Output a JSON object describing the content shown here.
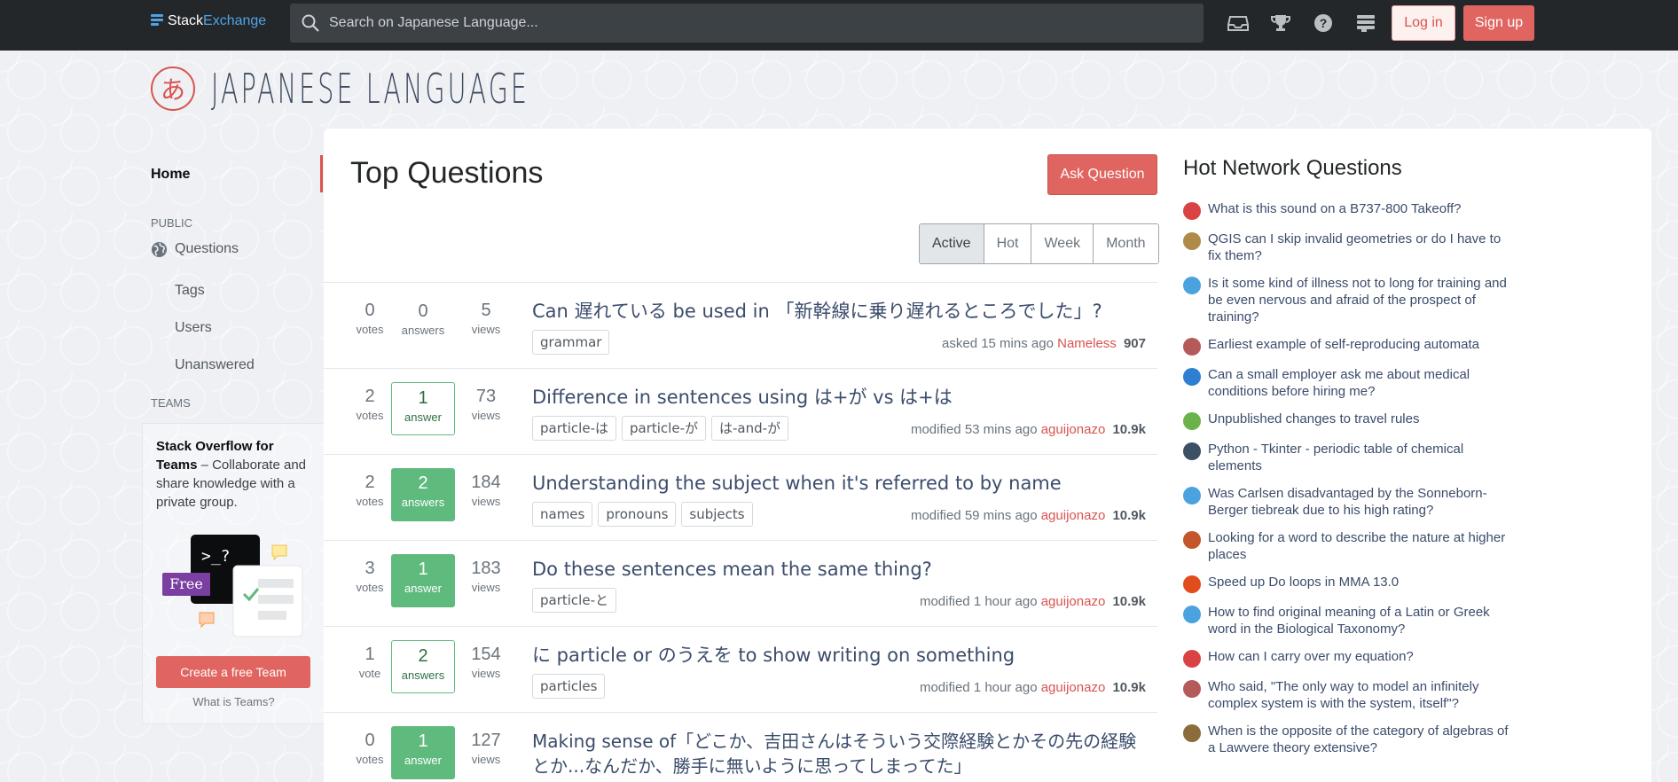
{
  "topbar": {
    "brand_part1": "Stack",
    "brand_part2": "Exchange",
    "search_placeholder": "Search on Japanese Language...",
    "icons": [
      "inbox-icon",
      "trophy-icon",
      "help-icon",
      "site-switcher-icon"
    ],
    "login": "Log in",
    "signup": "Sign up"
  },
  "site": {
    "logo_glyph": "あ",
    "name": "JAPANESE LANGUAGE"
  },
  "nav": {
    "home": "Home",
    "public_label": "PUBLIC",
    "questions": "Questions",
    "tags": "Tags",
    "users": "Users",
    "unanswered": "Unanswered",
    "teams_label": "TEAMS",
    "teams_bold": "Stack Overflow for Teams",
    "teams_rest": " – Collaborate and share knowledge with a private group.",
    "free_badge": "Free",
    "terminal_text": ">_?",
    "create_team": "Create a free Team",
    "what_is_teams": "What is Teams?"
  },
  "main": {
    "title": "Top Questions",
    "ask": "Ask Question",
    "filters": [
      "Active",
      "Hot",
      "Week",
      "Month"
    ],
    "questions": [
      {
        "votes": "0",
        "votes_label": "votes",
        "answers": "0",
        "answers_label": "answers",
        "answer_style": "none",
        "views": "5",
        "views_label": "views",
        "title": "Can 遅れている be used in 「新幹線に乗り遅れるところでした」?",
        "tags": [
          "grammar"
        ],
        "action": "asked 15 mins ago",
        "user": "Nameless",
        "rep": "907"
      },
      {
        "votes": "2",
        "votes_label": "votes",
        "answers": "1",
        "answers_label": "answer",
        "answer_style": "bordered",
        "views": "73",
        "views_label": "views",
        "title": "Difference in sentences using は+が vs は+は",
        "tags": [
          "particle-は",
          "particle-が",
          "は-and-が"
        ],
        "action": "modified 53 mins ago",
        "user": "aguijonazo",
        "rep": "10.9k"
      },
      {
        "votes": "2",
        "votes_label": "votes",
        "answers": "2",
        "answers_label": "answers",
        "answer_style": "accepted",
        "views": "184",
        "views_label": "views",
        "title": "Understanding the subject when it's referred to by name",
        "tags": [
          "names",
          "pronouns",
          "subjects"
        ],
        "action": "modified 59 mins ago",
        "user": "aguijonazo",
        "rep": "10.9k"
      },
      {
        "votes": "3",
        "votes_label": "votes",
        "answers": "1",
        "answers_label": "answer",
        "answer_style": "accepted",
        "views": "183",
        "views_label": "views",
        "title": "Do these sentences mean the same thing?",
        "tags": [
          "particle-と"
        ],
        "action": "modified 1 hour ago",
        "user": "aguijonazo",
        "rep": "10.9k"
      },
      {
        "votes": "1",
        "votes_label": "vote",
        "answers": "2",
        "answers_label": "answers",
        "answer_style": "bordered",
        "views": "154",
        "views_label": "views",
        "title": "に particle or のうえを to show writing on something",
        "tags": [
          "particles"
        ],
        "action": "modified 1 hour ago",
        "user": "aguijonazo",
        "rep": "10.9k"
      },
      {
        "votes": "0",
        "votes_label": "votes",
        "answers": "1",
        "answers_label": "answer",
        "answer_style": "accepted",
        "views": "127",
        "views_label": "views",
        "title": "Making sense of「どこか、吉田さんはそういう交際経験とかその先の経験とか...なんだか、勝手に無いように思ってしまってた」",
        "tags": [],
        "action": "",
        "user": "",
        "rep": ""
      }
    ]
  },
  "hnq": {
    "title": "Hot Network Questions",
    "items": [
      {
        "text": "What is this sound on a B737-800 Takeoff?",
        "color": "#d94343",
        "icon": "aviation-site-icon"
      },
      {
        "text": "QGIS can I skip invalid geometries or do I have to fix them?",
        "color": "#b08a48",
        "icon": "gis-site-icon"
      },
      {
        "text": "Is it some kind of illness not to long for training and be even nervous and afraid of the prospect of training?",
        "color": "#4aa3df",
        "icon": "fitness-site-icon"
      },
      {
        "text": "Earliest example of self-reproducing automata",
        "color": "#b55a5a",
        "icon": "history-site-icon"
      },
      {
        "text": "Can a small employer ask me about medical conditions before hiring me?",
        "color": "#2e7fd1",
        "icon": "workplace-site-icon"
      },
      {
        "text": "Unpublished changes to travel rules",
        "color": "#6bb24a",
        "icon": "travel-site-icon"
      },
      {
        "text": "Python - Tkinter - periodic table of chemical elements",
        "color": "#3c4f63",
        "icon": "codereview-site-icon"
      },
      {
        "text": "Was Carlsen disadvantaged by the Sonneborn-Berger tiebreak due to his high rating?",
        "color": "#4aa3df",
        "icon": "chess-site-icon"
      },
      {
        "text": "Looking for a word to describe the nature at higher places",
        "color": "#c4562b",
        "icon": "english-site-icon"
      },
      {
        "text": "Speed up Do loops in MMA 13.0",
        "color": "#e04c1b",
        "icon": "mathematica-site-icon"
      },
      {
        "text": "How to find original meaning of a Latin or Greek word in the Biological Taxonomy?",
        "color": "#4aa3df",
        "icon": "latin-site-icon"
      },
      {
        "text": "How can I carry over my equation?",
        "color": "#d94343",
        "icon": "tex-site-icon"
      },
      {
        "text": "Who said, \"The only way to model an infinitely complex system is with the system, itself\"?",
        "color": "#b55a5a",
        "icon": "philosophy-site-icon"
      },
      {
        "text": "When is the opposite of the category of algebras of a Lawvere theory extensive?",
        "color": "#8a6d3b",
        "icon": "mathoverflow-site-icon"
      }
    ]
  }
}
